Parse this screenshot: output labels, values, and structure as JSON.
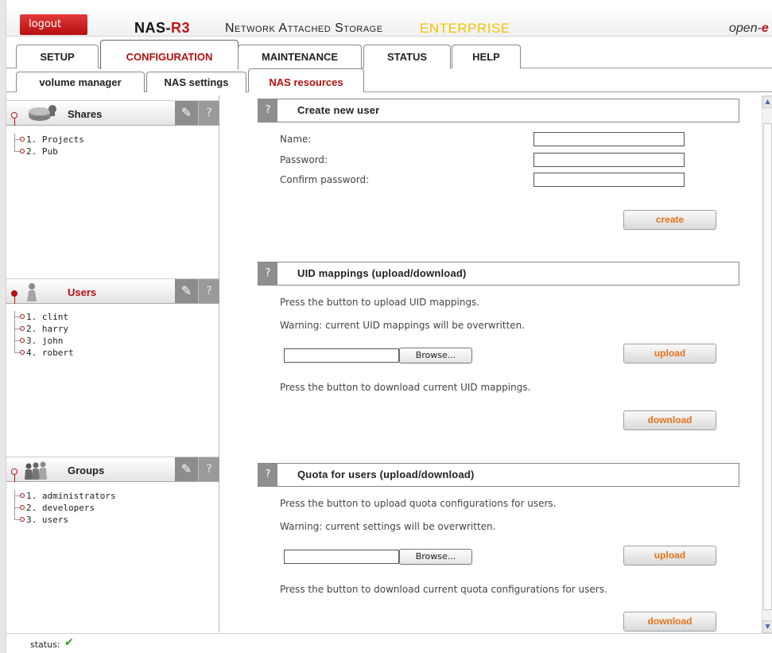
{
  "header": {
    "logout_label": "logout",
    "brand_prefix": "NAS-",
    "brand_suffix": "R3",
    "subtitle": "Network Attached Storage",
    "edition": "ENTERPRISE",
    "logo_prefix": "open-",
    "logo_suffix": "e"
  },
  "main_tabs": [
    {
      "label": "SETUP"
    },
    {
      "label": "CONFIGURATION",
      "active": true
    },
    {
      "label": "MAINTENANCE"
    },
    {
      "label": "STATUS"
    },
    {
      "label": "HELP"
    }
  ],
  "sub_tabs": [
    {
      "label": "volume manager"
    },
    {
      "label": "NAS settings"
    },
    {
      "label": "NAS resources",
      "active": true
    }
  ],
  "left_panels": {
    "shares": {
      "title": "Shares",
      "items": [
        "1. Projects",
        "2. Pub"
      ]
    },
    "users": {
      "title": "Users",
      "items": [
        "1. clint",
        "2. harry",
        "3. john",
        "4. robert"
      ]
    },
    "groups": {
      "title": "Groups",
      "items": [
        "1. administrators",
        "2. developers",
        "3. users"
      ]
    },
    "tool_icon": "wrench-icon",
    "help_glyph": "?"
  },
  "create_user": {
    "help_glyph": "?",
    "title": "Create new user",
    "name_label": "Name:",
    "password_label": "Password:",
    "confirm_label": "Confirm password:",
    "name_value": "",
    "password_value": "",
    "confirm_value": "",
    "create_button": "create"
  },
  "uid_mappings": {
    "help_glyph": "?",
    "title": "UID mappings (upload/download)",
    "upload_text": "Press the button to upload UID mappings.",
    "warning": "Warning: current UID mappings will be overwritten.",
    "file_value": "",
    "browse_button": "Browse...",
    "upload_button": "upload",
    "download_text": "Press the button to download current UID mappings.",
    "download_button": "download"
  },
  "quota": {
    "help_glyph": "?",
    "title": "Quota for users (upload/download)",
    "upload_text": "Press the button to upload quota configurations for users.",
    "warning": "Warning: current settings will be overwritten.",
    "file_value": "",
    "browse_button": "Browse...",
    "upload_button": "upload",
    "download_text": "Press the button to download current quota configurations for users.",
    "download_button": "download"
  },
  "status": {
    "label": "status:",
    "icon": "checkmark-icon",
    "color": "#2a9a1c"
  },
  "colors": {
    "accent_red": "#b31010",
    "button_orange": "#e8731a",
    "edition_yellow": "#f2c200"
  }
}
